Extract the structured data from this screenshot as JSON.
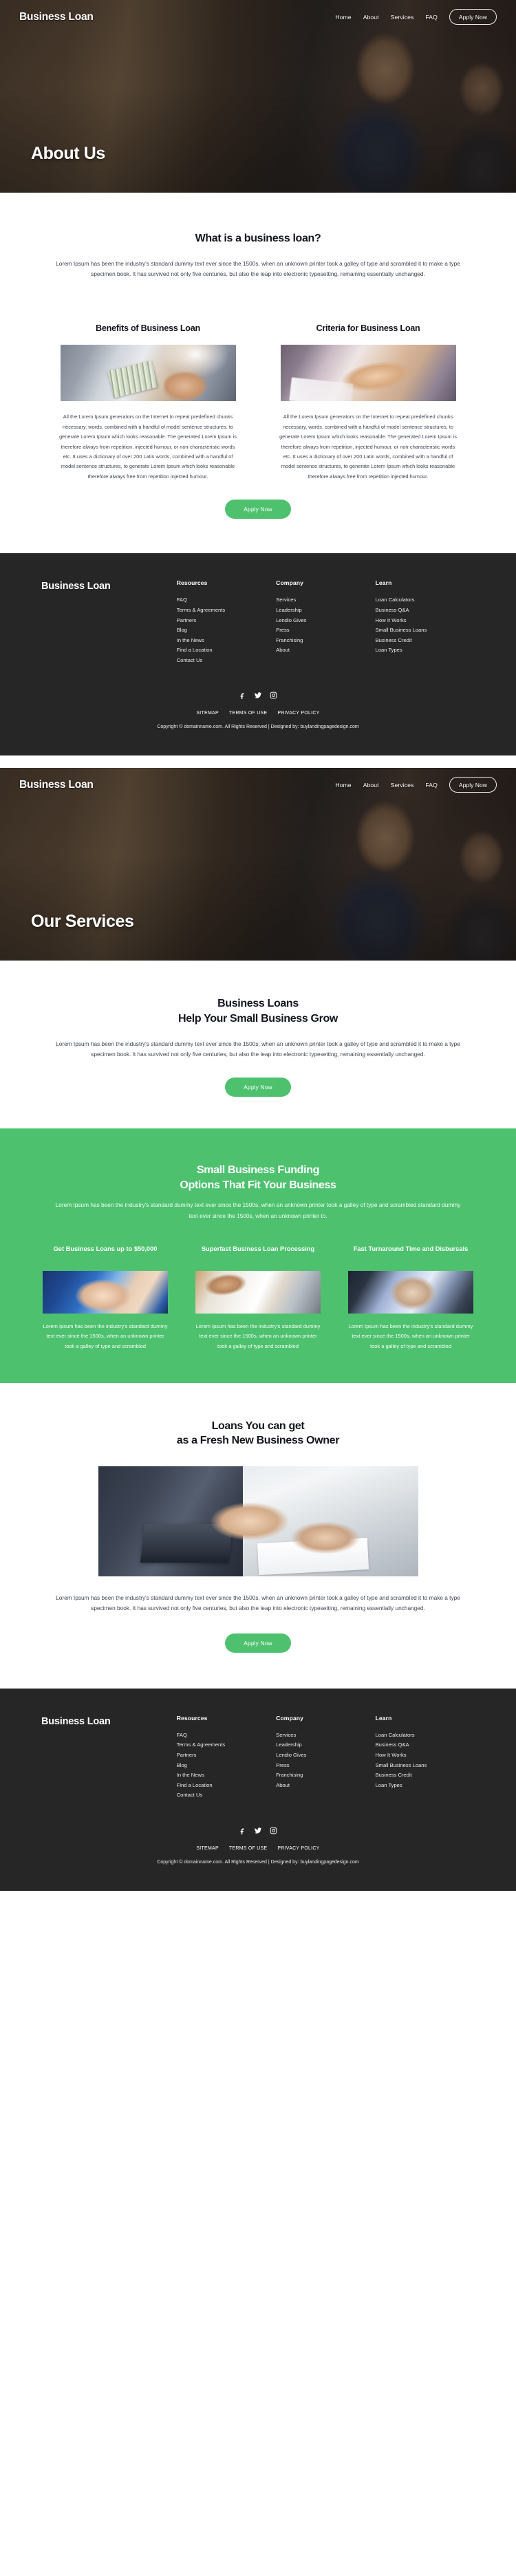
{
  "brand": "Business Loan",
  "colors": {
    "accent_green": "#4ec16f",
    "footer_dark": "#262626",
    "text_dark": "#13161d"
  },
  "nav": {
    "links": [
      "Home",
      "About",
      "Services",
      "FAQ"
    ],
    "cta": "Apply Now"
  },
  "page_about": {
    "hero_title": "About Us",
    "intro": {
      "title": "What is a business loan?",
      "body": "Lorem Ipsum has been the industry's standard dummy text ever since the 1500s, when an unknown printer took a galley of type and scrambled it to make a type specimen book. It has survived not only five centuries, but also the leap into electronic typesetting, remaining essentially unchanged."
    },
    "columns": [
      {
        "title": "Benefits of Business Loan",
        "image": "handing-cash-photo",
        "body": "All the Lorem Ipsum generators on the Internet to repeat predefined chunks necessary, words, combined with a handful of model sentence structures, to generate Lorem Ipsum which looks reasonable. The generated Lorem Ipsum is therefore always from repetition, injected humour, or non-characteristic words etc. It uses a dictionary of over 200 Latin words, combined with a handful of model sentence structures, to generate Lorem Ipsum which looks reasonable therefore always free from repetition injected humour."
      },
      {
        "title": "Criteria for Business Loan",
        "image": "handshake-photo",
        "body": "All the Lorem Ipsum generators on the Internet to repeat predefined chunks necessary, words, combined with a handful of model sentence structures, to generate Lorem Ipsum which looks reasonable. The generated Lorem Ipsum is therefore always from repetition, injected humour, or non-characteristic words etc. It uses a dictionary of over 200 Latin words, combined with a handful of model sentence structures, to generate Lorem Ipsum which looks reasonable therefore always free from repetition injected humour."
      }
    ],
    "cta": "Apply Now"
  },
  "page_services": {
    "hero_title": "Our Services",
    "intro": {
      "title_line1": "Business Loans",
      "title_line2": "Help Your Small Business Grow",
      "body": "Lorem Ipsum has been the industry's standard dummy text ever since the 1500s, when an unknown printer took a galley of type and scrambled it to make a type specimen book. It has survived not only five centuries, but also the leap into electronic typesetting, remaining essentially unchanged.",
      "cta": "Apply Now"
    },
    "funding": {
      "title_line1": "Small Business Funding",
      "title_line2": "Options That Fit Your Business",
      "body": "Lorem Ipsum has been the industry's standard dummy text ever since the 1500s, when an unknown printer took a galley of type and scrambled standard dummy text ever since the 1500s, when an unknown printer to.",
      "cards": [
        {
          "title": "Get Business Loans up to $50,000",
          "image": "credit-card-photo",
          "body": "Lorem Ipsum has been the industry's standard dummy text ever since the 1500s, when an unknown printer took a galley of type and scrambled"
        },
        {
          "title": "Superfast Business Loan Processing",
          "image": "paperwork-photo",
          "body": "Lorem Ipsum has been the industry's standard dummy text ever since the 1500s, when an unknown printer took a galley of type and scrambled"
        },
        {
          "title": "Fast Turnaround Time and Disbursals",
          "image": "businessman-desk-photo",
          "body": "Lorem Ipsum has been the industry's standard dummy text ever since the 1500s, when an unknown printer took a galley of type and scrambled"
        }
      ]
    },
    "loans": {
      "title_line1": "Loans You can get",
      "title_line2": "as a Fresh New Business Owner",
      "image": "office-meeting-photo",
      "body": "Lorem Ipsum has been the industry's standard dummy text ever since the 1500s, when an unknown printer took a galley of type and scrambled it to make a type specimen book. It has survived not only five centuries, but also the leap into electronic typesetting, remaining essentially unchanged.",
      "cta": "Apply Now"
    }
  },
  "footer": {
    "brand": "Business Loan",
    "columns": [
      {
        "title": "Resources",
        "links": [
          "FAQ",
          "Terms & Agreements",
          "Partners",
          "Blog",
          "In the News",
          "Find a Location",
          "Contact Us"
        ]
      },
      {
        "title": "Company",
        "links": [
          "Services",
          "Leadership",
          "Lendio Gives",
          "Press",
          "Franchising",
          "About"
        ]
      },
      {
        "title": "Learn",
        "links": [
          "Loan Calculators",
          "Business Q&A",
          "How It Works",
          "Small Business Loans",
          "Business Credit",
          "Loan Types"
        ]
      }
    ],
    "social": [
      "facebook-icon",
      "twitter-icon",
      "instagram-icon"
    ],
    "legal": [
      "SITEMAP",
      "TERMS OF USE",
      "PRIVACY POLICY"
    ],
    "copyright": "Copyright © domainname.com. All Rights Reserved | Designed by: buylandingpagedesign.com"
  }
}
